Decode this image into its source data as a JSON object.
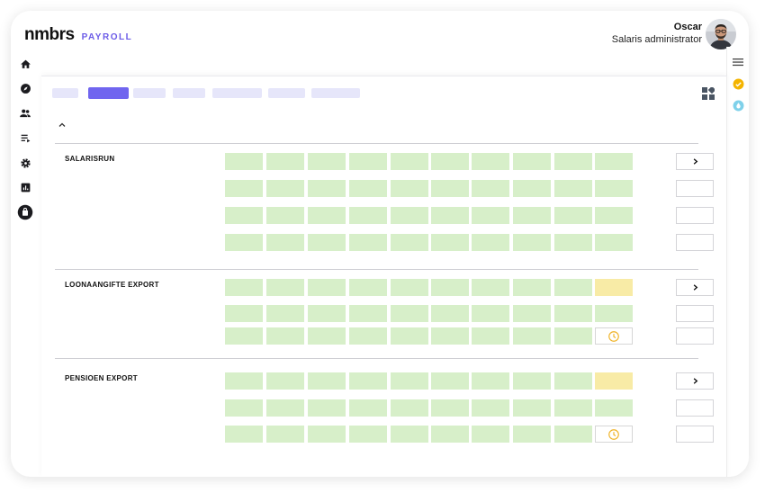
{
  "app": {
    "brand": "nmbrs",
    "product": "PAYROLL"
  },
  "user": {
    "name": "Oscar",
    "role": "Salaris administrator"
  },
  "nav": [
    {
      "icon": "home-icon"
    },
    {
      "icon": "compass-icon"
    },
    {
      "icon": "people-icon"
    },
    {
      "icon": "list-icon"
    },
    {
      "icon": "gear-icon"
    },
    {
      "icon": "chart-icon"
    },
    {
      "icon": "bag-icon"
    }
  ],
  "right_icons": [
    "menu-icon",
    "check-circle-icon",
    "drop-icon"
  ],
  "colors": {
    "accent": "#7065ef",
    "tab": "#e6e6fa",
    "done": "#d7efc9",
    "pending": "#f8eba6",
    "clock": "#f0b429"
  },
  "tabs": [
    {
      "active": false
    },
    {
      "active": true
    },
    {
      "active": false
    },
    {
      "active": false
    },
    {
      "active": false
    },
    {
      "active": false
    },
    {
      "active": false
    }
  ],
  "sections": [
    {
      "label": "SALARISRUN",
      "rows": [
        [
          "done",
          "done",
          "done",
          "done",
          "done",
          "done",
          "done",
          "done",
          "done",
          "done"
        ],
        [
          "done",
          "done",
          "done",
          "done",
          "done",
          "done",
          "done",
          "done",
          "done",
          "done"
        ],
        [
          "done",
          "done",
          "done",
          "done",
          "done",
          "done",
          "done",
          "done",
          "done",
          "done"
        ],
        [
          "done",
          "done",
          "done",
          "done",
          "done",
          "done",
          "done",
          "done",
          "done",
          "done"
        ]
      ]
    },
    {
      "label": "LOONAANGIFTE EXPORT",
      "rows": [
        [
          "done",
          "done",
          "done",
          "done",
          "done",
          "done",
          "done",
          "done",
          "done",
          "pending"
        ],
        [
          "done",
          "done",
          "done",
          "done",
          "done",
          "done",
          "done",
          "done",
          "done",
          "done"
        ],
        [
          "done",
          "done",
          "done",
          "done",
          "done",
          "done",
          "done",
          "done",
          "done",
          "clock"
        ]
      ]
    },
    {
      "label": "PENSIOEN EXPORT",
      "rows": [
        [
          "done",
          "done",
          "done",
          "done",
          "done",
          "done",
          "done",
          "done",
          "done",
          "pending"
        ],
        [
          "done",
          "done",
          "done",
          "done",
          "done",
          "done",
          "done",
          "done",
          "done",
          "done"
        ],
        [
          "done",
          "done",
          "done",
          "done",
          "done",
          "done",
          "done",
          "done",
          "done",
          "clock"
        ]
      ]
    }
  ]
}
